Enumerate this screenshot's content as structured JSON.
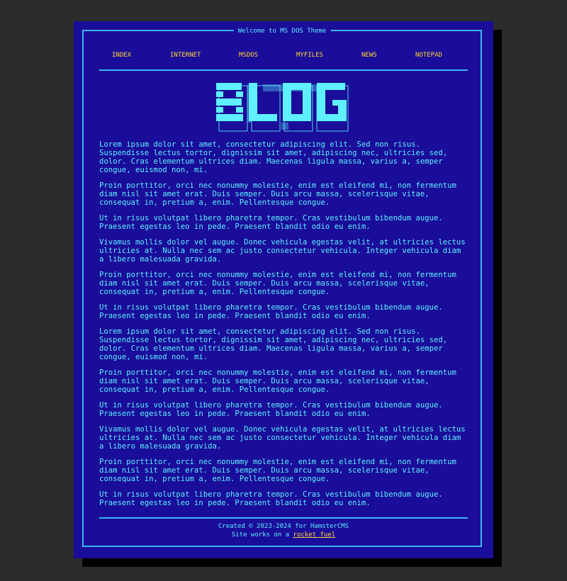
{
  "theme_title": "Welcome to MS DOS Theme",
  "nav": {
    "items": [
      {
        "label": "INDEX"
      },
      {
        "label": "INTERNET"
      },
      {
        "label": "MSDOS"
      },
      {
        "label": "MYFILES"
      },
      {
        "label": "NEWS"
      },
      {
        "label": "NOTEPAD"
      }
    ]
  },
  "logo": {
    "text": "BLOG",
    "color": "#5ff0ff"
  },
  "content": {
    "paragraphs": [
      "Lorem ipsum dolor sit amet, consectetur adipiscing elit. Sed non risus.\nSuspendisse lectus tortor, dignissim sit amet, adipiscing nec, ultricies sed,\ndolor. Cras elementum ultrices diam. Maecenas ligula massa, varius a, semper\ncongue, euismod non, mi.",
      "Proin porttitor, orci nec nonummy molestie, enim est eleifend mi, non fermentum\ndiam nisl sit amet erat. Duis semper. Duis arcu massa, scelerisque vitae,\nconsequat in, pretium a, enim. Pellentesque congue.",
      "Ut in risus volutpat libero pharetra tempor. Cras vestibulum bibendum augue.\nPraesent egestas leo in pede. Praesent blandit odio eu enim.",
      "Vivamus mollis dolor vel augue. Donec vehicula egestas velit, at ultricies lectus\nultricies at. Nulla nec sem ac justo consectetur vehicula. Integer vehicula diam\na libero malesuada gravida.",
      "Proin porttitor, orci nec nonummy molestie, enim est eleifend mi, non fermentum\ndiam nisl sit amet erat. Duis semper. Duis arcu massa, scelerisque vitae,\nconsequat in, pretium a, enim. Pellentesque congue.",
      "Ut in risus volutpat libero pharetra tempor. Cras vestibulum bibendum augue.\nPraesent egestas leo in pede. Praesent blandit odio eu enim.",
      "Lorem ipsum dolor sit amet, consectetur adipiscing elit. Sed non risus.\nSuspendisse lectus tortor, dignissim sit amet, adipiscing nec, ultricies sed,\ndolor. Cras elementum ultrices diam. Maecenas ligula massa, varius a, semper\ncongue, euismod non, mi.",
      "Proin porttitor, orci nec nonummy molestie, enim est eleifend mi, non fermentum\ndiam nisl sit amet erat. Duis semper. Duis arcu massa, scelerisque vitae,\nconsequat in, pretium a, enim. Pellentesque congue.",
      "Ut in risus volutpat libero pharetra tempor. Cras vestibulum bibendum augue.\nPraesent egestas leo in pede. Praesent blandit odio eu enim.",
      "Vivamus mollis dolor vel augue. Donec vehicula egestas velit, at ultricies lectus\nultricies at. Nulla nec sem ac justo consectetur vehicula. Integer vehicula diam\na libero malesuada gravida.",
      "Proin porttitor, orci nec nonummy molestie, enim est eleifend mi, non fermentum\ndiam nisl sit amet erat. Duis semper. Duis arcu massa, scelerisque vitae,\nconsequat in, pretium a, enim. Pellentesque congue.",
      "Ut in risus volutpat libero pharetra tempor. Cras vestibulum bibendum augue.\nPraesent egestas leo in pede. Praesent blandit odio eu enim."
    ]
  },
  "footer": {
    "credit": "Created © 2023-2024 for HamsterCMS",
    "works_prefix": "Site works on a ",
    "link_label": "rocket fuel"
  },
  "colors": {
    "background": "#2c2c2c",
    "window": "#1a0d99",
    "border": "#3fb6f2",
    "text": "#5ff0ff",
    "accent": "#ffd633"
  }
}
